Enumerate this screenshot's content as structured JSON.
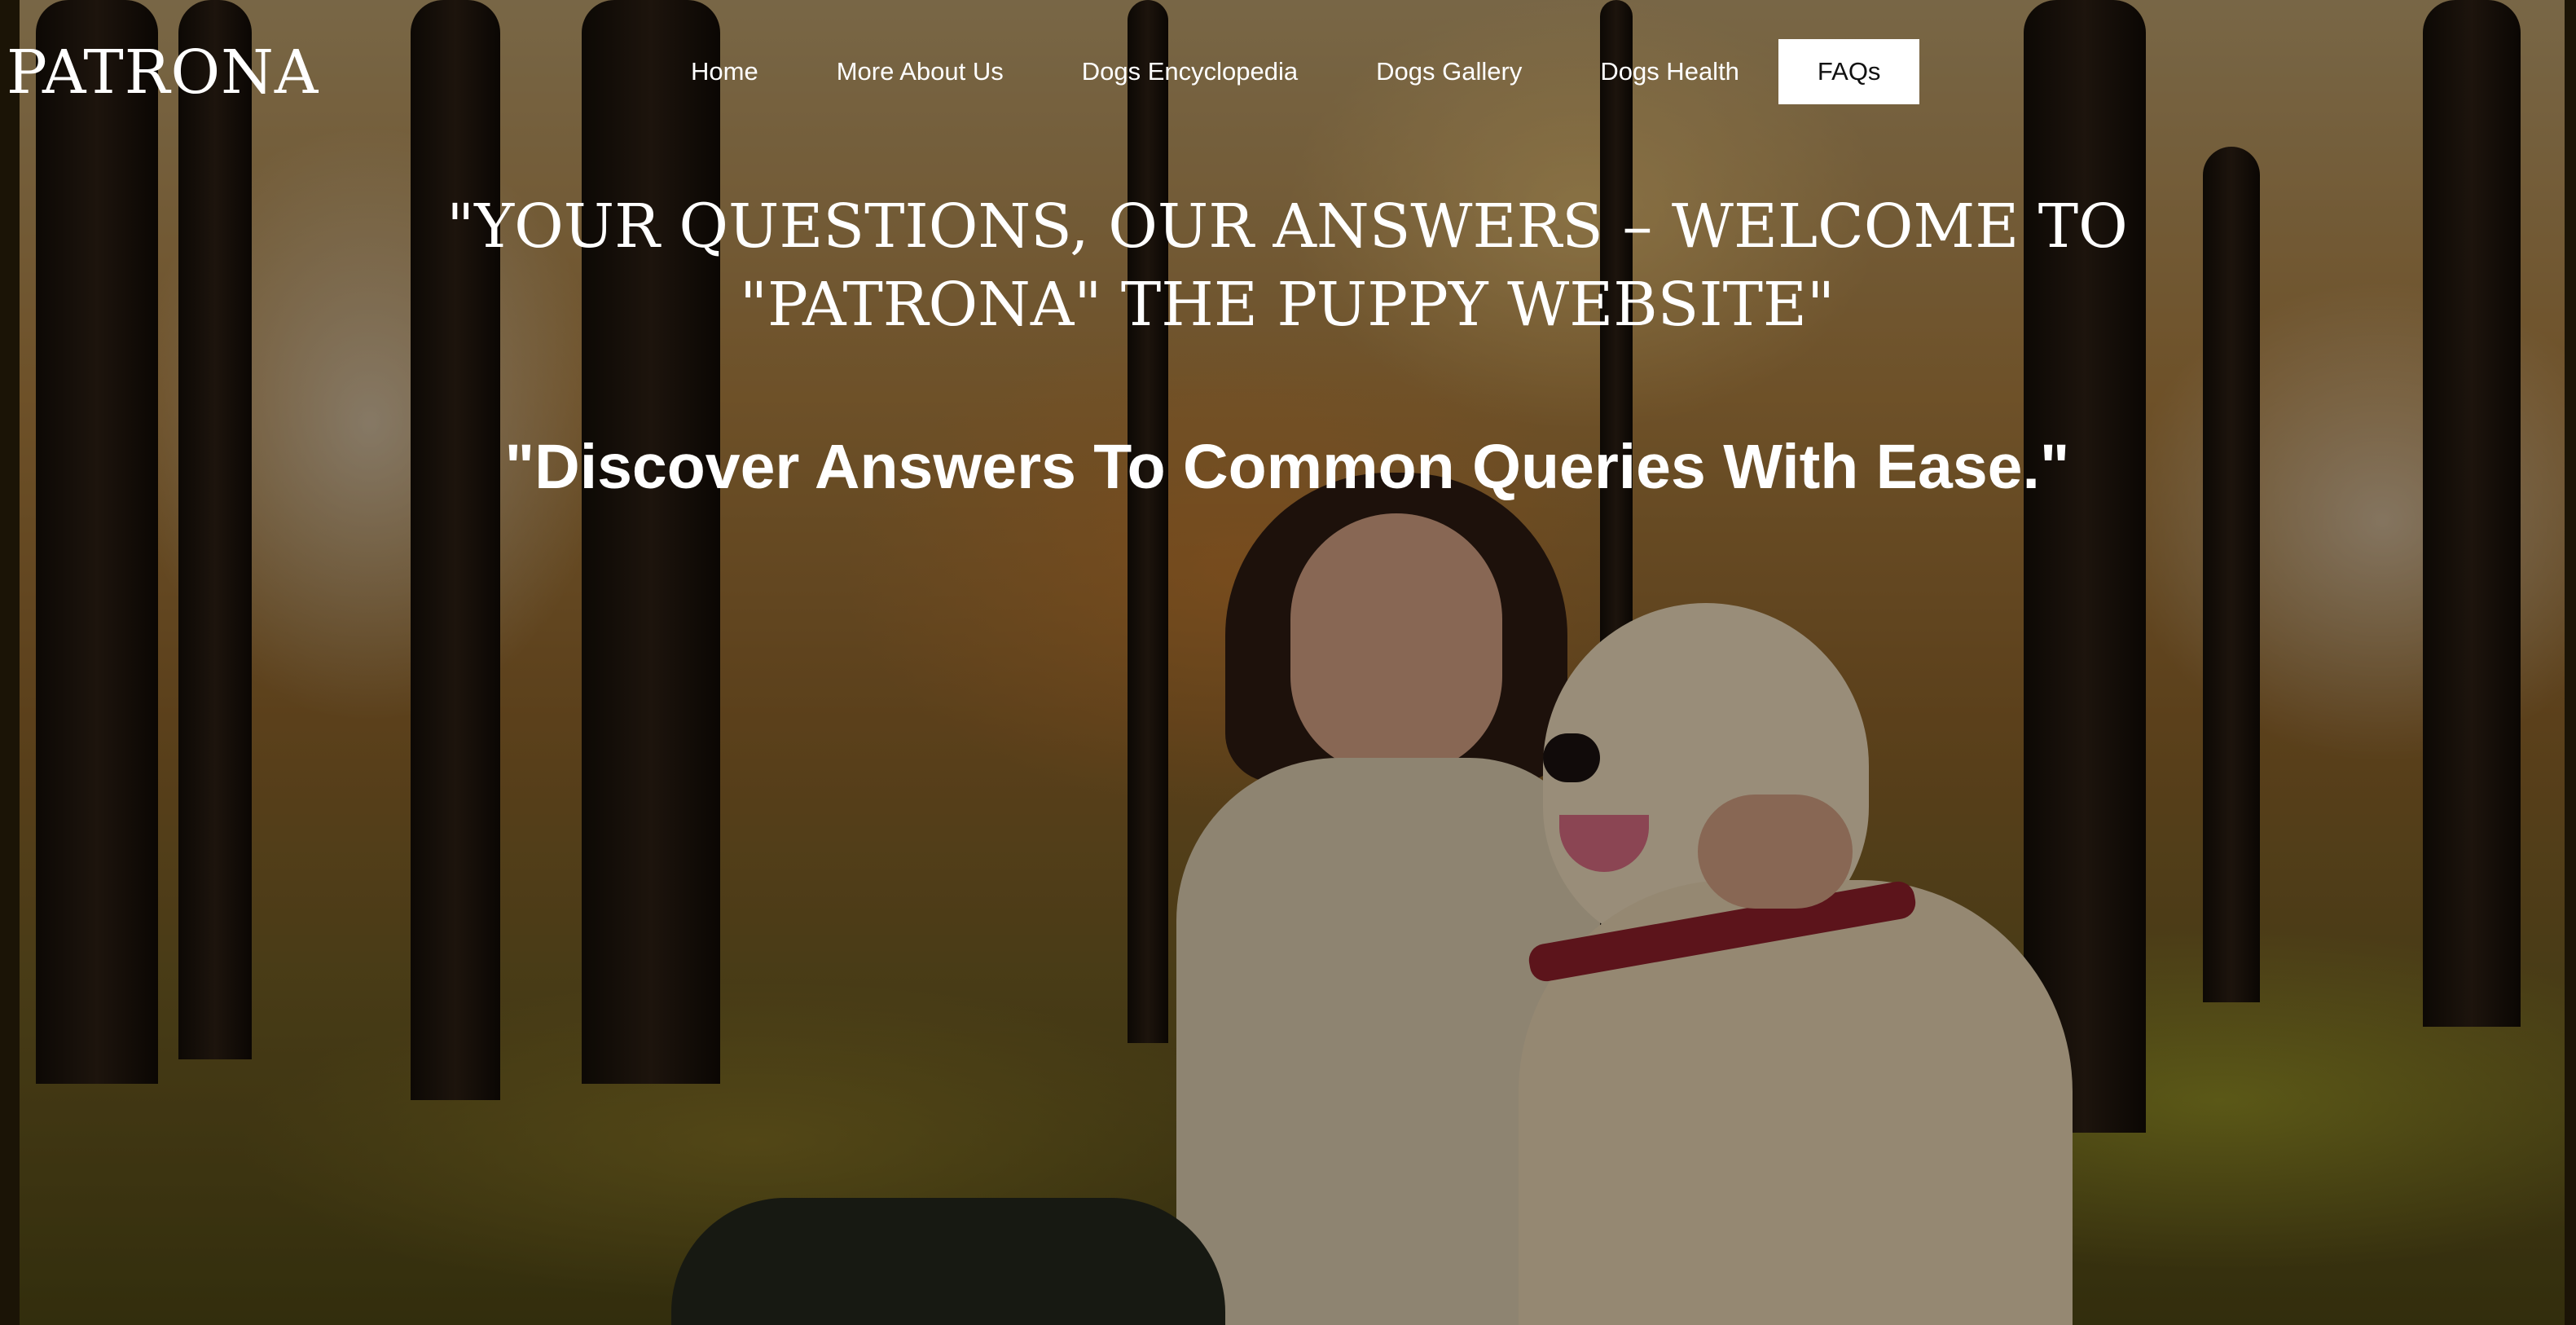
{
  "brand": {
    "name": "PATRONA"
  },
  "nav": {
    "items": [
      {
        "label": "Home"
      },
      {
        "label": "More About Us"
      },
      {
        "label": "Dogs Encyclopedia"
      },
      {
        "label": "Dogs Gallery"
      },
      {
        "label": "Dogs Health"
      },
      {
        "label": "FAQs"
      }
    ],
    "active": "FAQs"
  },
  "hero": {
    "headline_line1": "\"YOUR QUESTIONS, OUR ANSWERS – WELCOME TO",
    "headline_line2": "\"PATRONA\" THE PUPPY WEBSITE\"",
    "subheadline": "\"Discover Answers To Common Queries With Ease.\""
  },
  "colors": {
    "text": "#ffffff",
    "active_tab_bg": "#ffffff",
    "active_tab_text": "#111111"
  }
}
